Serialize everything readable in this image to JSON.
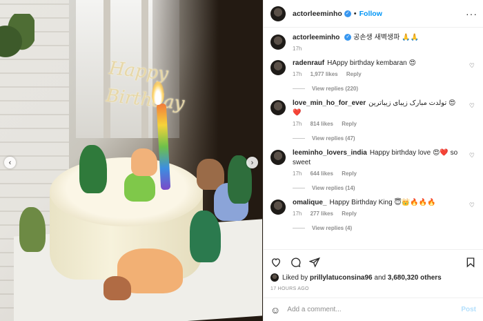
{
  "post": {
    "username": "actorleeminho",
    "follow_label": "Follow",
    "more_label": "···",
    "verified_mark": "✓",
    "separator": "•"
  },
  "photo": {
    "sign_text": "Happy Birthday",
    "prev_label": "‹",
    "next_label": "›"
  },
  "caption": {
    "username": "actorleeminho",
    "text": "공손생 새벽생파 🙏🙏",
    "time": "17h"
  },
  "comments": [
    {
      "username": "radenrauf",
      "text": "HAppy birthday kembaran 😍",
      "time": "17h",
      "likes": "1,977 likes",
      "reply": "Reply",
      "replies": "View replies (220)"
    },
    {
      "username": "love_min_ho_for_ever",
      "text": "تولدت مبارک زیبای زیباترین 😍❤️",
      "time": "17h",
      "likes": "814 likes",
      "reply": "Reply",
      "replies": "View replies (47)"
    },
    {
      "username": "leeminho_lovers_india",
      "text": "Happy birthday love 😍❤️ so sweet",
      "time": "17h",
      "likes": "644 likes",
      "reply": "Reply",
      "replies": "View replies (14)"
    },
    {
      "username": "omalique_",
      "text": "Happy Birthday King 😇👑🔥🔥🔥",
      "time": "17h",
      "likes": "277 likes",
      "reply": "Reply",
      "replies": "View replies (4)"
    }
  ],
  "likes": {
    "prefix": "Liked by",
    "user": "prillylatuconsina96",
    "middle": "and",
    "count": "3,680,320 others"
  },
  "timestamp": "17 HOURS AGO",
  "add_comment": {
    "emoji": "☺",
    "placeholder": "Add a comment...",
    "post_label": "Post"
  },
  "colors": {
    "accent": "#0095f6",
    "verified": "#3897f0",
    "muted": "#8e8e8e",
    "post_disabled": "#b2dffc"
  },
  "icons": {
    "like": "heart-icon",
    "comment": "comment-icon",
    "share": "share-icon",
    "save": "bookmark-icon",
    "emoji": "emoji-icon",
    "more": "more-icon"
  }
}
